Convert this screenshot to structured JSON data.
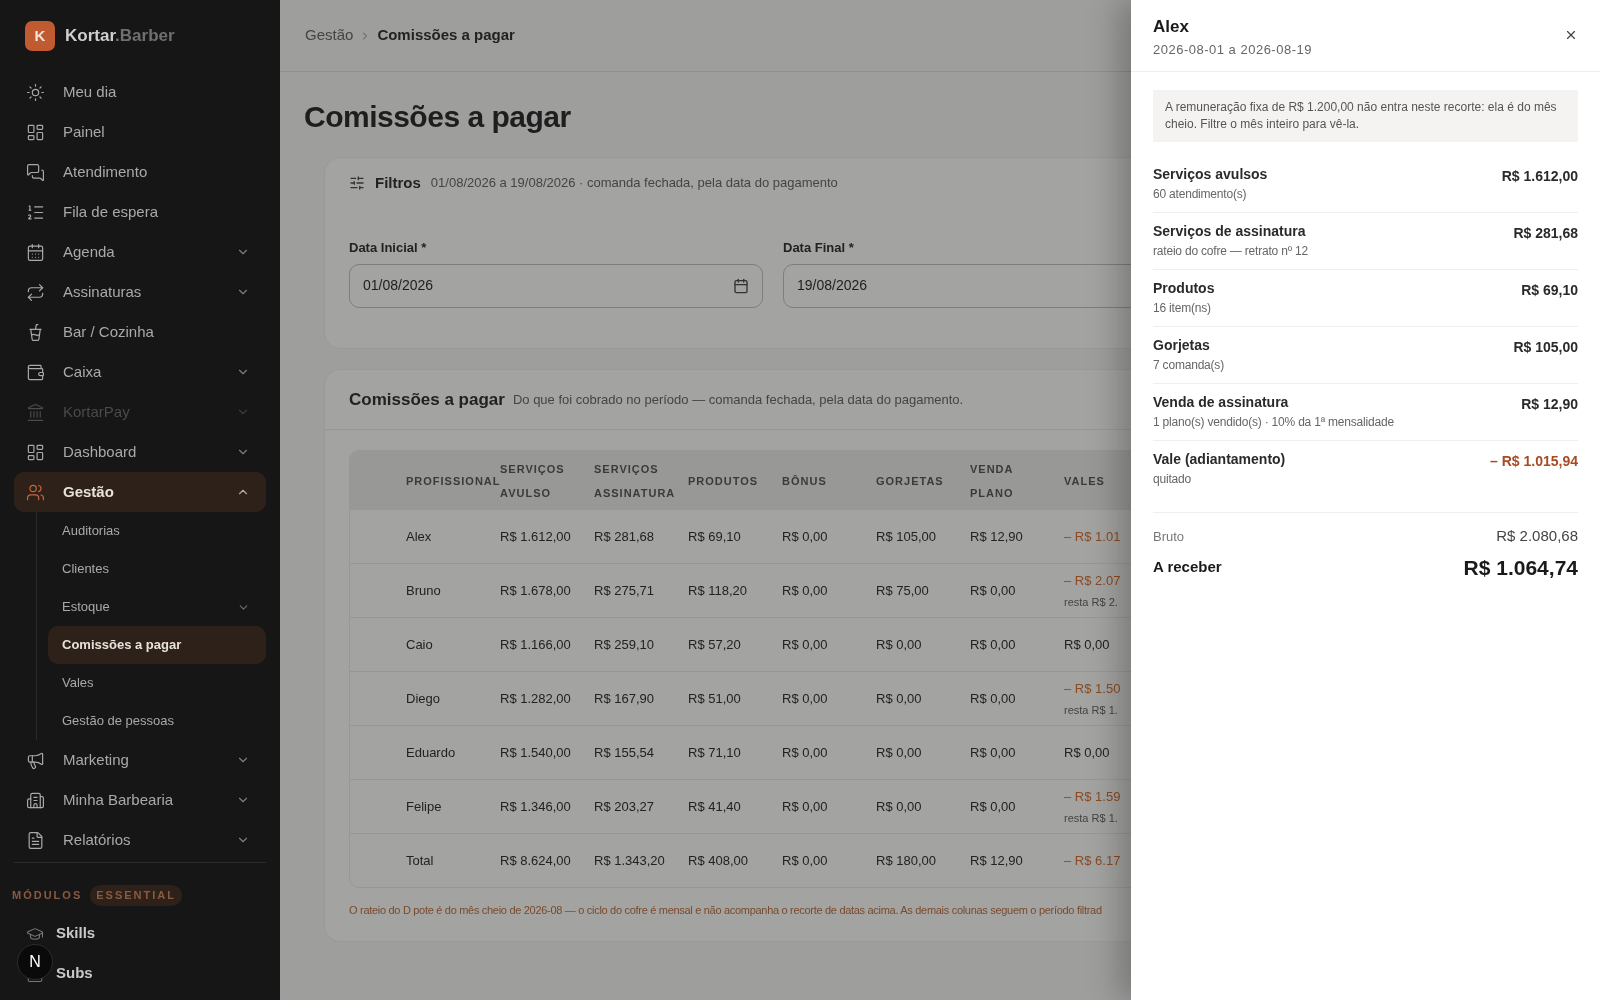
{
  "brand": {
    "logo_letter": "K",
    "name": "Kortar",
    "suffix": ".Barber"
  },
  "sidebar": {
    "items": [
      {
        "label": "Meu dia",
        "expandable": false,
        "selected": false,
        "disabled": false
      },
      {
        "label": "Painel",
        "expandable": false,
        "selected": false,
        "disabled": false
      },
      {
        "label": "Atendimento",
        "expandable": false,
        "selected": false,
        "disabled": false
      },
      {
        "label": "Fila de espera",
        "expandable": false,
        "selected": false,
        "disabled": false
      },
      {
        "label": "Agenda",
        "expandable": true,
        "expanded": false,
        "selected": false,
        "disabled": false
      },
      {
        "label": "Assinaturas",
        "expandable": true,
        "expanded": false,
        "selected": false,
        "disabled": false
      },
      {
        "label": "Bar / Cozinha",
        "expandable": false,
        "selected": false,
        "disabled": false
      },
      {
        "label": "Caixa",
        "expandable": true,
        "expanded": false,
        "selected": false,
        "disabled": false
      },
      {
        "label": "KortarPay",
        "expandable": true,
        "expanded": false,
        "selected": false,
        "disabled": true
      },
      {
        "label": "Dashboard",
        "expandable": true,
        "expanded": false,
        "selected": false,
        "disabled": false
      },
      {
        "label": "Gestão",
        "expandable": true,
        "expanded": true,
        "selected": true,
        "disabled": false,
        "children": [
          {
            "label": "Auditorias",
            "expandable": false,
            "selected": false
          },
          {
            "label": "Clientes",
            "expandable": false,
            "selected": false
          },
          {
            "label": "Estoque",
            "expandable": true,
            "selected": false
          },
          {
            "label": "Comissões a pagar",
            "expandable": false,
            "selected": true
          },
          {
            "label": "Vales",
            "expandable": false,
            "selected": false
          },
          {
            "label": "Gestão de pessoas",
            "expandable": false,
            "selected": false
          }
        ]
      },
      {
        "label": "Marketing",
        "expandable": true,
        "expanded": false,
        "selected": false,
        "disabled": false
      },
      {
        "label": "Minha Barbearia",
        "expandable": true,
        "expanded": false,
        "selected": false,
        "disabled": false
      },
      {
        "label": "Relatórios",
        "expandable": true,
        "expanded": false,
        "selected": false,
        "disabled": false
      }
    ],
    "modules": {
      "label": "MÓDULOS",
      "badge": "ESSENTIAL",
      "items": [
        {
          "label": "Skills"
        },
        {
          "label": "Subs"
        }
      ]
    },
    "floating_button": "N"
  },
  "breadcrumb": [
    "Gestão",
    "Comissões a pagar"
  ],
  "page_title": "Comissões a pagar",
  "filters": {
    "title": "Filtros",
    "summary": "01/08/2026 a 19/08/2026 · comanda fechada, pela data do pagamento",
    "fields": [
      {
        "label": "Data Inicial *",
        "value": "01/08/2026"
      },
      {
        "label": "Data Final *",
        "value": "19/08/2026"
      }
    ]
  },
  "table": {
    "title": "Comissões a pagar",
    "subtitle": "Do que foi cobrado no período — comanda fechada, pela data do pagamento.",
    "columns": [
      "PROFISSIONAL",
      "SERVIÇOS AVULSO",
      "SERVIÇOS ASSINATURA",
      "PRODUTOS",
      "BÔNUS",
      "GORJETAS",
      "VENDA PLANO",
      "VALES"
    ],
    "rows": [
      {
        "cells": [
          "Alex",
          "R$ 1.612,00",
          "R$ 281,68",
          "R$ 69,10",
          "R$ 0,00",
          "R$ 105,00",
          "R$ 12,90"
        ],
        "vales": {
          "amount": "– R$ 1.01",
          "negative": true
        }
      },
      {
        "cells": [
          "Bruno",
          "R$ 1.678,00",
          "R$ 275,71",
          "R$ 118,20",
          "R$ 0,00",
          "R$ 75,00",
          "R$ 0,00"
        ],
        "vales": {
          "amount": "– R$ 2.07",
          "negative": true,
          "note": "resta R$ 2."
        }
      },
      {
        "cells": [
          "Caio",
          "R$ 1.166,00",
          "R$ 259,10",
          "R$ 57,20",
          "R$ 0,00",
          "R$ 0,00",
          "R$ 0,00"
        ],
        "vales": {
          "amount": "R$ 0,00",
          "negative": false
        }
      },
      {
        "cells": [
          "Diego",
          "R$ 1.282,00",
          "R$ 167,90",
          "R$ 51,00",
          "R$ 0,00",
          "R$ 0,00",
          "R$ 0,00"
        ],
        "vales": {
          "amount": "– R$ 1.50",
          "negative": true,
          "note": "resta R$ 1."
        }
      },
      {
        "cells": [
          "Eduardo",
          "R$ 1.540,00",
          "R$ 155,54",
          "R$ 71,10",
          "R$ 0,00",
          "R$ 0,00",
          "R$ 0,00"
        ],
        "vales": {
          "amount": "R$ 0,00",
          "negative": false
        }
      },
      {
        "cells": [
          "Felipe",
          "R$ 1.346,00",
          "R$ 203,27",
          "R$ 41,40",
          "R$ 0,00",
          "R$ 0,00",
          "R$ 0,00"
        ],
        "vales": {
          "amount": "– R$ 1.59",
          "negative": true,
          "note": "resta R$ 1."
        }
      },
      {
        "cells": [
          "Total",
          "R$ 8.624,00",
          "R$ 1.343,20",
          "R$ 408,00",
          "R$ 0,00",
          "R$ 180,00",
          "R$ 12,90"
        ],
        "vales": {
          "amount": "– R$ 6.17",
          "negative": true
        }
      }
    ],
    "footnote": "O rateio do D pote é do mês cheio de 2026-08 — o ciclo do cofre é mensal e não acompanha o recorte de datas acima. As demais colunas seguem o período filtrad"
  },
  "drawer": {
    "title": "Alex",
    "subtitle": "2026-08-01 a 2026-08-19",
    "note": "A remuneração fixa de R$ 1.200,00 não entra neste recorte: ela é do mês cheio. Filtre o mês inteiro para vê-la.",
    "items": [
      {
        "label": "Serviços avulsos",
        "detail": "60 atendimento(s)",
        "amount": "R$ 1.612,00",
        "negative": false
      },
      {
        "label": "Serviços de assinatura",
        "detail": "rateio do cofre — retrato nº 12",
        "amount": "R$ 281,68",
        "negative": false
      },
      {
        "label": "Produtos",
        "detail": "16 item(ns)",
        "amount": "R$ 69,10",
        "negative": false
      },
      {
        "label": "Gorjetas",
        "detail": "7 comanda(s)",
        "amount": "R$ 105,00",
        "negative": false
      },
      {
        "label": "Venda de assinatura",
        "detail": "1 plano(s) vendido(s) · 10% da 1ª mensalidade",
        "amount": "R$ 12,90",
        "negative": false
      },
      {
        "label": "Vale (adiantamento)",
        "detail": "quitado",
        "amount": "– R$ 1.015,94",
        "negative": true
      }
    ],
    "gross": {
      "label": "Bruto",
      "value": "R$ 2.080,68"
    },
    "net": {
      "label": "A receber",
      "value": "R$ 1.064,74"
    }
  }
}
